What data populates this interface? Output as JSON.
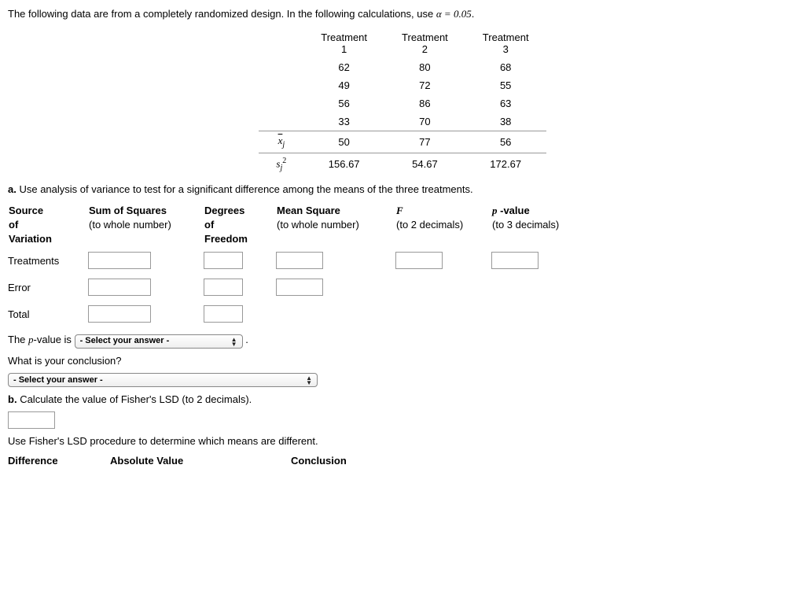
{
  "intro_prefix": "The following data are from a completely randomized design. In the following calculations, use ",
  "alpha_expr": "α = 0.05",
  "intro_suffix": ".",
  "data_table": {
    "headers": [
      "Treatment 1",
      "Treatment 2",
      "Treatment 3"
    ],
    "rows": [
      [
        "62",
        "80",
        "68"
      ],
      [
        "49",
        "72",
        "55"
      ],
      [
        "56",
        "86",
        "63"
      ],
      [
        "33",
        "70",
        "38"
      ]
    ],
    "mean_label_html": "x̄_j",
    "means": [
      "50",
      "77",
      "56"
    ],
    "var_label_html": "s_j^2",
    "variances": [
      "156.67",
      "54.67",
      "172.67"
    ]
  },
  "part_a_label": "a.",
  "part_a_text": "Use analysis of variance to test for a significant difference among the means of the three treatments.",
  "anova": {
    "col1_lines": [
      "Source",
      "of",
      "Variation"
    ],
    "col2_lines": [
      "Sum of Squares",
      "(to whole number)"
    ],
    "col3_lines": [
      "Degrees",
      "of",
      "Freedom"
    ],
    "col4_lines": [
      "Mean Square",
      "(to whole number)"
    ],
    "col5_lines": [
      "F",
      "(to 2 decimals)"
    ],
    "col6_lines": [
      "p -value",
      "(to 3 decimals)"
    ],
    "rows": [
      "Treatments",
      "Error",
      "Total"
    ]
  },
  "pvalue_sentence_prefix": "The ",
  "pvalue_sentence_mid": "-value is",
  "select_placeholder": "- Select your answer -",
  "period": ".",
  "conclusion_q": "What is your conclusion?",
  "part_b_label": "b.",
  "part_b_text": "Calculate the value of Fisher's LSD (to 2 decimals).",
  "fisher_instruction": "Use Fisher's LSD procedure to determine which means are different.",
  "lsd_headers": {
    "diff": "Difference",
    "abs": "Absolute Value",
    "conc": "Conclusion"
  },
  "chart_data": {
    "type": "table",
    "title": "Observations by Treatment (Completely Randomized Design)",
    "categories": [
      "Treatment 1",
      "Treatment 2",
      "Treatment 3"
    ],
    "rows": [
      [
        62,
        80,
        68
      ],
      [
        49,
        72,
        55
      ],
      [
        56,
        86,
        63
      ],
      [
        33,
        70,
        38
      ]
    ],
    "summary": {
      "mean": [
        50,
        77,
        56
      ],
      "variance": [
        156.67,
        54.67,
        172.67
      ]
    },
    "alpha": 0.05
  }
}
